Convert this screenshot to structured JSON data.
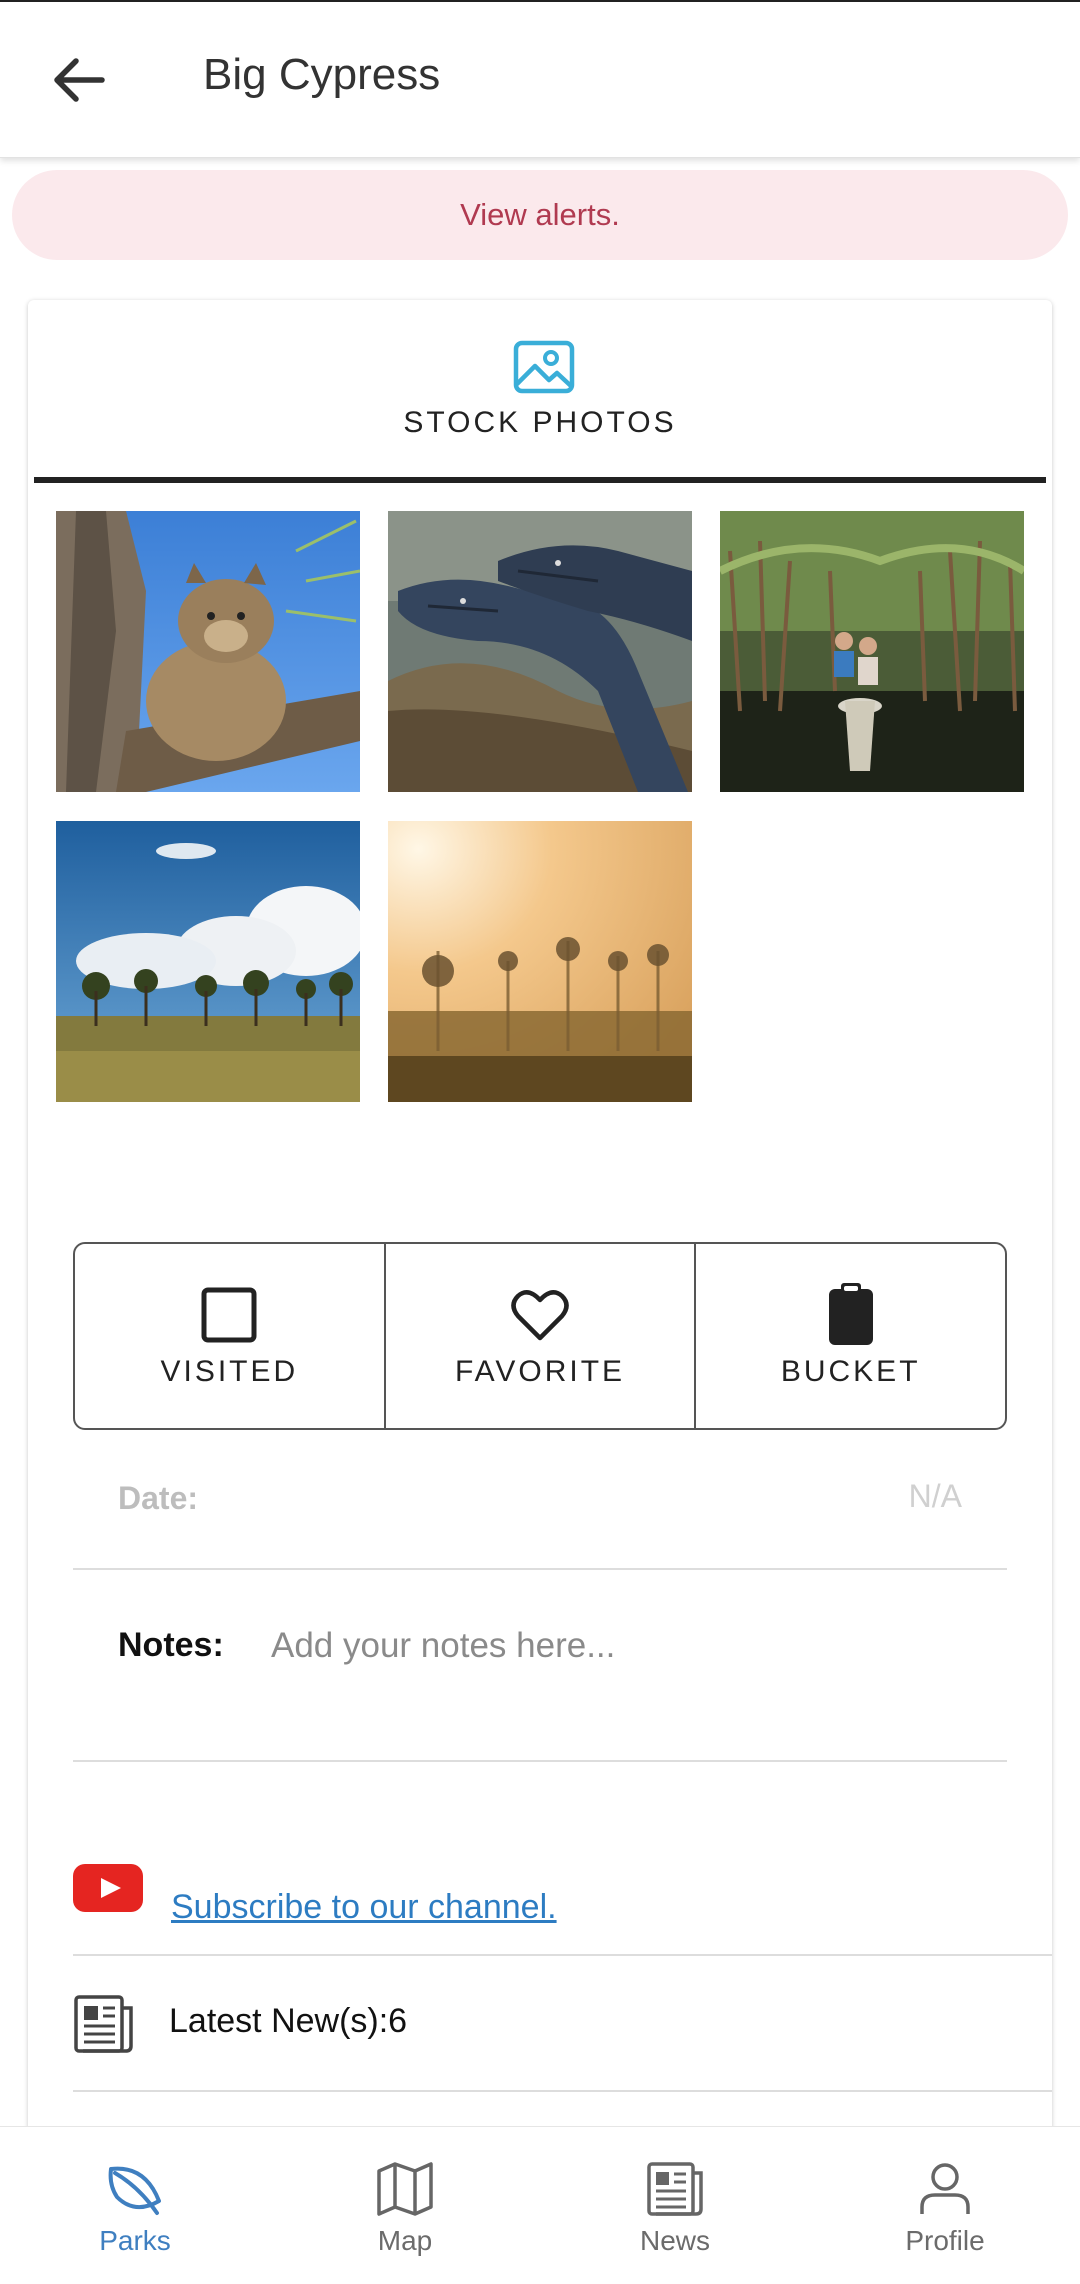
{
  "header": {
    "title": "Big Cypress",
    "back_icon": "arrow-left-icon"
  },
  "alert": {
    "text": "View alerts.",
    "color": "#b03a50",
    "background": "#fbe9ec"
  },
  "photos_tab": {
    "label": "STOCK PHOTOS",
    "icon": "image-icon",
    "icon_color": "#3aaed8"
  },
  "photos": [
    {
      "subject": "panther-in-tree"
    },
    {
      "subject": "alligators"
    },
    {
      "subject": "canoe-in-mangroves"
    },
    {
      "subject": "cypress-prairie-clouds"
    },
    {
      "subject": "misty-cypress-sunrise"
    }
  ],
  "actions": [
    {
      "label": "VISITED",
      "icon": "checkbox-empty-icon"
    },
    {
      "label": "FAVORITE",
      "icon": "heart-outline-icon"
    },
    {
      "label": "BUCKET",
      "icon": "clipboard-icon"
    }
  ],
  "date": {
    "label": "Date:",
    "value": "N/A"
  },
  "notes": {
    "label": "Notes:",
    "placeholder": "Add your notes here..."
  },
  "youtube": {
    "icon": "youtube-icon",
    "link_text": "Subscribe to our channel."
  },
  "news": {
    "icon": "newspaper-icon",
    "text": "Latest New(s):6"
  },
  "bottom_nav": {
    "active_color": "#3f7fc0",
    "items": [
      {
        "label": "Parks",
        "icon": "leaf-icon",
        "active": true
      },
      {
        "label": "Map",
        "icon": "map-icon",
        "active": false
      },
      {
        "label": "News",
        "icon": "newspaper-icon",
        "active": false
      },
      {
        "label": "Profile",
        "icon": "person-icon",
        "active": false
      }
    ]
  }
}
